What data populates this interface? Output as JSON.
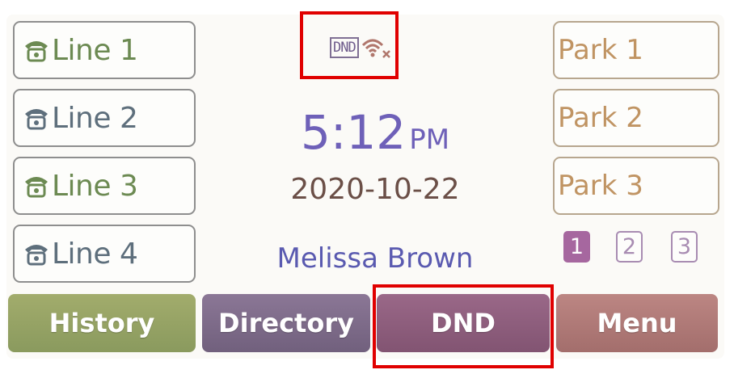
{
  "status": {
    "dnd_badge": "DND",
    "wifi_icon": "wifi-disconnected-icon"
  },
  "lines": [
    {
      "label": "Line 1",
      "icon": "phone-handset-icon",
      "color": "#6c8a52"
    },
    {
      "label": "Line 2",
      "icon": "phone-handset-icon",
      "color": "#5e6f7c"
    },
    {
      "label": "Line 3",
      "icon": "phone-handset-icon",
      "color": "#6c8a52"
    },
    {
      "label": "Line 4",
      "icon": "phone-handset-icon",
      "color": "#5e6f7c"
    }
  ],
  "parks": [
    {
      "label": "Park 1"
    },
    {
      "label": "Park 2"
    },
    {
      "label": "Park 3"
    }
  ],
  "clock": {
    "time": "5:12",
    "ampm": "PM"
  },
  "date": "2020-10-22",
  "user": "Melissa Brown",
  "pages": [
    "1",
    "2",
    "3"
  ],
  "active_page": "1",
  "softkeys": [
    {
      "label": "History",
      "color": "#92a063"
    },
    {
      "label": "Directory",
      "color": "#7c668a"
    },
    {
      "label": "DND",
      "color": "#8f5e7d"
    },
    {
      "label": "Menu",
      "color": "#b07a78"
    }
  ],
  "colors": {
    "highlight": "#e00000",
    "accent_purple": "#6e60b8"
  }
}
